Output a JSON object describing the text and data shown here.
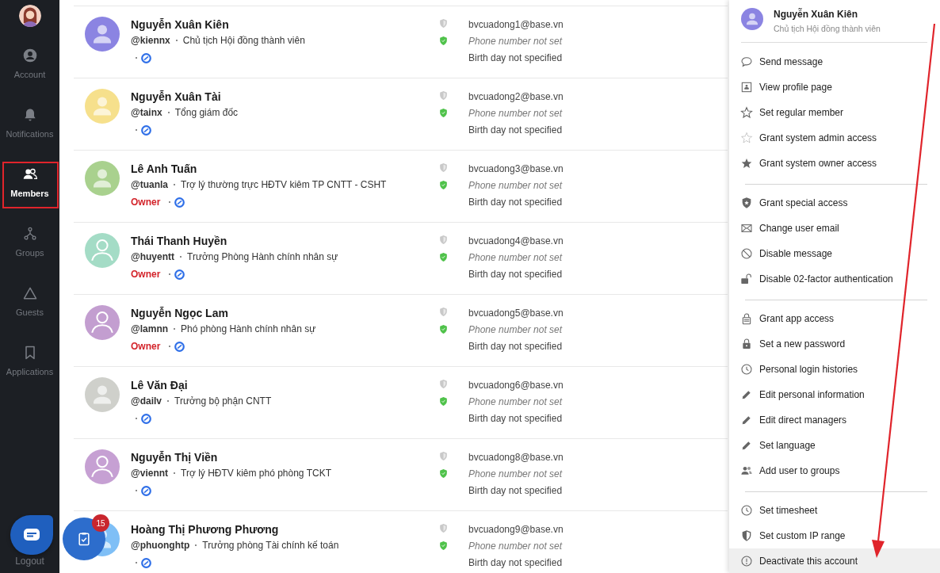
{
  "sidebar": {
    "items": [
      {
        "label": "Account",
        "selected": false
      },
      {
        "label": "Notifications",
        "selected": false
      },
      {
        "label": "Members",
        "selected": true
      },
      {
        "label": "Groups",
        "selected": false
      },
      {
        "label": "Guests",
        "selected": false
      },
      {
        "label": "Applications",
        "selected": false
      }
    ],
    "logout": "Logout"
  },
  "members": [
    {
      "name": "Nguyễn Xuân Kiên",
      "handle": "@kiennx",
      "title": "Chủ tịch Hội đồng thành viên",
      "color": "#8b84e2",
      "kind": "filled",
      "email": "bvcuadong1@base.vn",
      "phone": "Phone number not set",
      "birthday": "Birth day not specified"
    },
    {
      "name": "Nguyễn Xuân Tài",
      "handle": "@tainx",
      "title": "Tổng giám đốc",
      "color": "#f6e08c",
      "kind": "filled",
      "email": "bvcuadong2@base.vn",
      "phone": "Phone number not set",
      "birthday": "Birth day not specified"
    },
    {
      "name": "Lê Anh Tuấn",
      "handle": "@tuanla",
      "title": "Trợ lý thường trực HĐTV kiêm TP CNTT - CSHT",
      "role": "Owner",
      "color": "#a9d18e",
      "kind": "filled",
      "email": "bvcuadong3@base.vn",
      "phone": "Phone number not set",
      "birthday": "Birth day not specified"
    },
    {
      "name": "Thái Thanh Huyền",
      "handle": "@huyentt",
      "title": "Trưởng Phòng Hành chính nhân sự",
      "role": "Owner",
      "color": "#a4dcc6",
      "kind": "outline",
      "email": "bvcuadong4@base.vn",
      "phone": "Phone number not set",
      "birthday": "Birth day not specified"
    },
    {
      "name": "Nguyễn Ngọc Lam",
      "handle": "@lamnn",
      "title": "Phó phòng Hành chính nhân sự",
      "role": "Owner",
      "color": "#c39ed0",
      "kind": "outline",
      "email": "bvcuadong5@base.vn",
      "phone": "Phone number not set",
      "birthday": "Birth day not specified"
    },
    {
      "name": "Lê Văn Đại",
      "handle": "@dailv",
      "title": "Trưởng bộ phận CNTT",
      "color": "#cfd0cb",
      "kind": "filled",
      "email": "bvcuadong6@base.vn",
      "phone": "Phone number not set",
      "birthday": "Birth day not specified"
    },
    {
      "name": "Nguyễn Thị Viền",
      "handle": "@viennt",
      "title": "Trợ lý HĐTV kiêm phó phòng TCKT",
      "color": "#c6a0d3",
      "kind": "outline",
      "email": "bvcuadong8@base.vn",
      "phone": "Phone number not set",
      "birthday": "Birth day not specified"
    },
    {
      "name": "Hoàng Thị Phương Phương",
      "handle": "@phuonghtp",
      "title": "Trưởng phòng Tài chính kế toán",
      "color": "#7fbff6",
      "kind": "filled",
      "email": "bvcuadong9@base.vn",
      "phone": "Phone number not set",
      "birthday": "Birth day not specified"
    }
  ],
  "action_panel": {
    "user": {
      "name": "Nguyễn Xuân Kiên",
      "title": "Chủ tịch Hội đồng thành viên",
      "color": "#8b84e2"
    },
    "sections": [
      {
        "items": [
          {
            "label": "Send message",
            "selected": false
          },
          {
            "label": "View profile page",
            "selected": false
          },
          {
            "label": "Set regular member",
            "selected": false
          },
          {
            "label": "Grant system admin access",
            "selected": false
          },
          {
            "label": "Grant system owner access",
            "selected": false
          }
        ]
      },
      {
        "items": [
          {
            "label": "Grant special access",
            "selected": false
          },
          {
            "label": "Change user email",
            "selected": false
          },
          {
            "label": "Disable message",
            "selected": false
          },
          {
            "label": "Disable 02-factor authentication",
            "selected": false
          }
        ]
      },
      {
        "items": [
          {
            "label": "Grant app access",
            "selected": false
          },
          {
            "label": "Set a new password",
            "selected": false
          },
          {
            "label": "Personal login histories",
            "selected": false
          },
          {
            "label": "Edit personal information",
            "selected": false
          },
          {
            "label": "Edit direct managers",
            "selected": false
          },
          {
            "label": "Set language",
            "selected": false
          },
          {
            "label": "Add user to groups",
            "selected": false
          }
        ]
      },
      {
        "items": [
          {
            "label": "Set timesheet",
            "selected": false
          },
          {
            "label": "Set custom IP range",
            "selected": false
          },
          {
            "label": "Deactivate this account",
            "selected": true
          }
        ]
      }
    ]
  },
  "task_button": {
    "badge": "15"
  }
}
